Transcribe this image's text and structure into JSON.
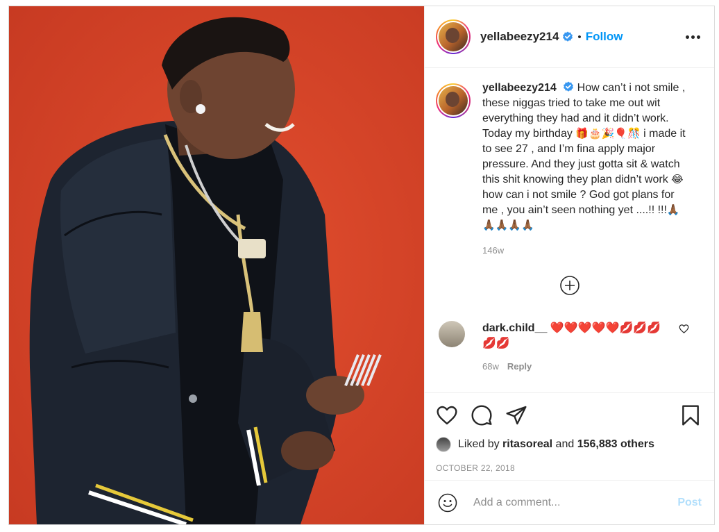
{
  "header": {
    "username": "yellabeezy214",
    "separator": "•",
    "follow_label": "Follow"
  },
  "caption": {
    "username": "yellabeezy214",
    "text_part1": "How can’t i not smile , these niggas tried to take me out wit everything they had and it didn’t work. Today my birthday ",
    "emoji_group1": "🎁🎂🎉🎈🎊",
    "text_part2": " i made it to see 27 , and I’m fina apply major pressure. And they just gotta sit & watch this shit knowing they plan didn’t work ",
    "emoji_group2": "😂",
    "text_part3": " how can i not smile ? God got plans for me , you ain’t seen nothing yet ....!! !!!",
    "emoji_group3": "🙏🏾🙏🏾🙏🏾🙏🏾🙏🏾",
    "time": "146w"
  },
  "comment": {
    "username": "dark.child__",
    "text": "❤️❤️❤️❤️❤️💋💋💋💋💋",
    "time": "68w",
    "reply_label": "Reply"
  },
  "likes": {
    "prefix": "Liked by ",
    "user": "ritasoreal",
    "middle": " and ",
    "count": "156,883 others"
  },
  "date": "OCTOBER 22, 2018",
  "add_comment": {
    "placeholder": "Add a comment...",
    "post_label": "Post"
  },
  "colors": {
    "accent": "#0095f6",
    "background_photo": "#d8462a",
    "post_disabled": "#b2dffc",
    "heart_red": "#ed4956"
  },
  "icons": {
    "more": "more-options-icon",
    "verified": "verified-badge-icon",
    "like": "heart-icon",
    "comment": "comment-bubble-icon",
    "share": "paper-plane-icon",
    "save": "bookmark-icon",
    "emoji": "smiley-icon",
    "load_more": "plus-circle-icon"
  }
}
